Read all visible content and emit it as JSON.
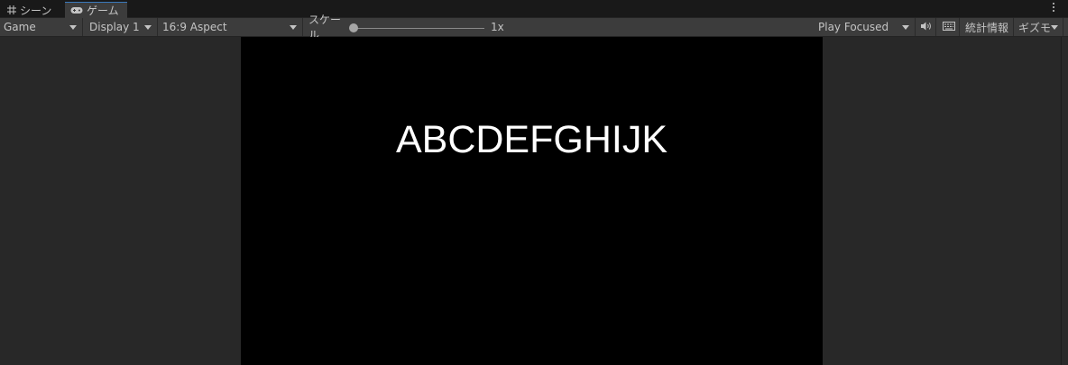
{
  "tabs": [
    {
      "label": "シーン",
      "icon": "grid-icon"
    },
    {
      "label": "ゲーム",
      "icon": "gamepad-icon",
      "active": true
    }
  ],
  "toolbar": {
    "view_mode": "Game",
    "display": "Display 1",
    "aspect": "16:9 Aspect",
    "scale_label": "スケール",
    "scale_value": "1x",
    "scale_fraction": 0.0,
    "play_mode": "Play Focused",
    "stats_label": "統計情報",
    "gizmos_label": "ギズモ"
  },
  "game": {
    "text": "ABCDEFGHIJK"
  },
  "colors": {
    "accent": "#3a79bb",
    "background": "#282828",
    "toolbar": "#3c3c3c",
    "viewport": "#000000"
  }
}
